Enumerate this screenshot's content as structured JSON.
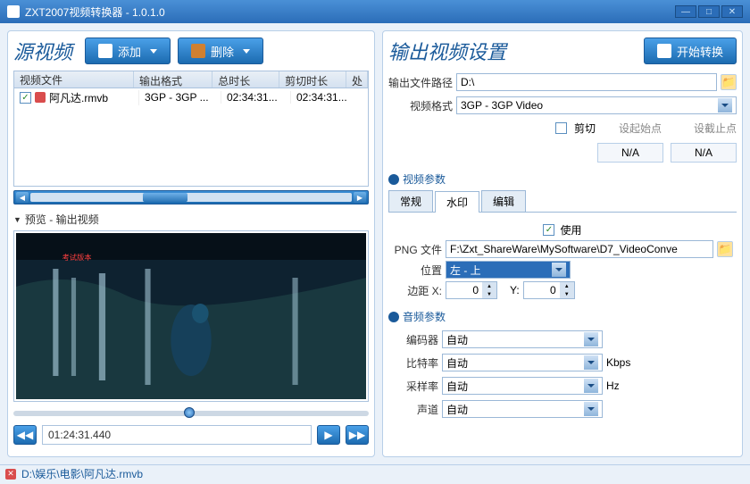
{
  "window": {
    "title": "ZXT2007视频转换器 - 1.0.1.0"
  },
  "left_panel": {
    "title": "源视频",
    "add_label": "添加",
    "remove_label": "删除",
    "grid_headers": {
      "file": "视频文件",
      "fmt": "输出格式",
      "dur": "总时长",
      "cut": "剪切时长",
      "proc": "处"
    },
    "rows": [
      {
        "checked": true,
        "file": "阿凡达.rmvb",
        "fmt": "3GP - 3GP ...",
        "dur": "02:34:31...",
        "cut": "02:34:31..."
      }
    ],
    "preview_label": "预览 - 输出视频",
    "playback_time": "01:24:31.440"
  },
  "right_panel": {
    "title": "输出视频设置",
    "start_label": "开始转换",
    "output_path_label": "输出文件路径",
    "output_path_value": "D:\\",
    "video_fmt_label": "视频格式",
    "video_fmt_value": "3GP - 3GP Video",
    "trim": {
      "checkbox_label": "剪切",
      "set_start_label": "设起始点",
      "set_end_label": "设截止点",
      "na": "N/A"
    },
    "video_params_title": "视频参数",
    "tabs": {
      "normal": "常规",
      "watermark": "水印",
      "edit": "编辑"
    },
    "watermark": {
      "use_label": "使用",
      "png_label": "PNG 文件",
      "png_value": "F:\\Zxt_ShareWare\\MySoftware\\D7_VideoConve",
      "pos_label": "位置",
      "pos_value": "左 - 上",
      "margin_x_label": "边距 X:",
      "margin_y_label": "Y:",
      "margin_x": "0",
      "margin_y": "0"
    },
    "audio_params_title": "音频参数",
    "audio": {
      "encoder_label": "编码器",
      "encoder_value": "自动",
      "bitrate_label": "比特率",
      "bitrate_value": "自动",
      "bitrate_unit": "Kbps",
      "sample_label": "采样率",
      "sample_value": "自动",
      "sample_unit": "Hz",
      "channel_label": "声道",
      "channel_value": "自动"
    }
  },
  "statusbar": {
    "path": "D:\\娱乐\\电影\\阿凡达.rmvb"
  }
}
